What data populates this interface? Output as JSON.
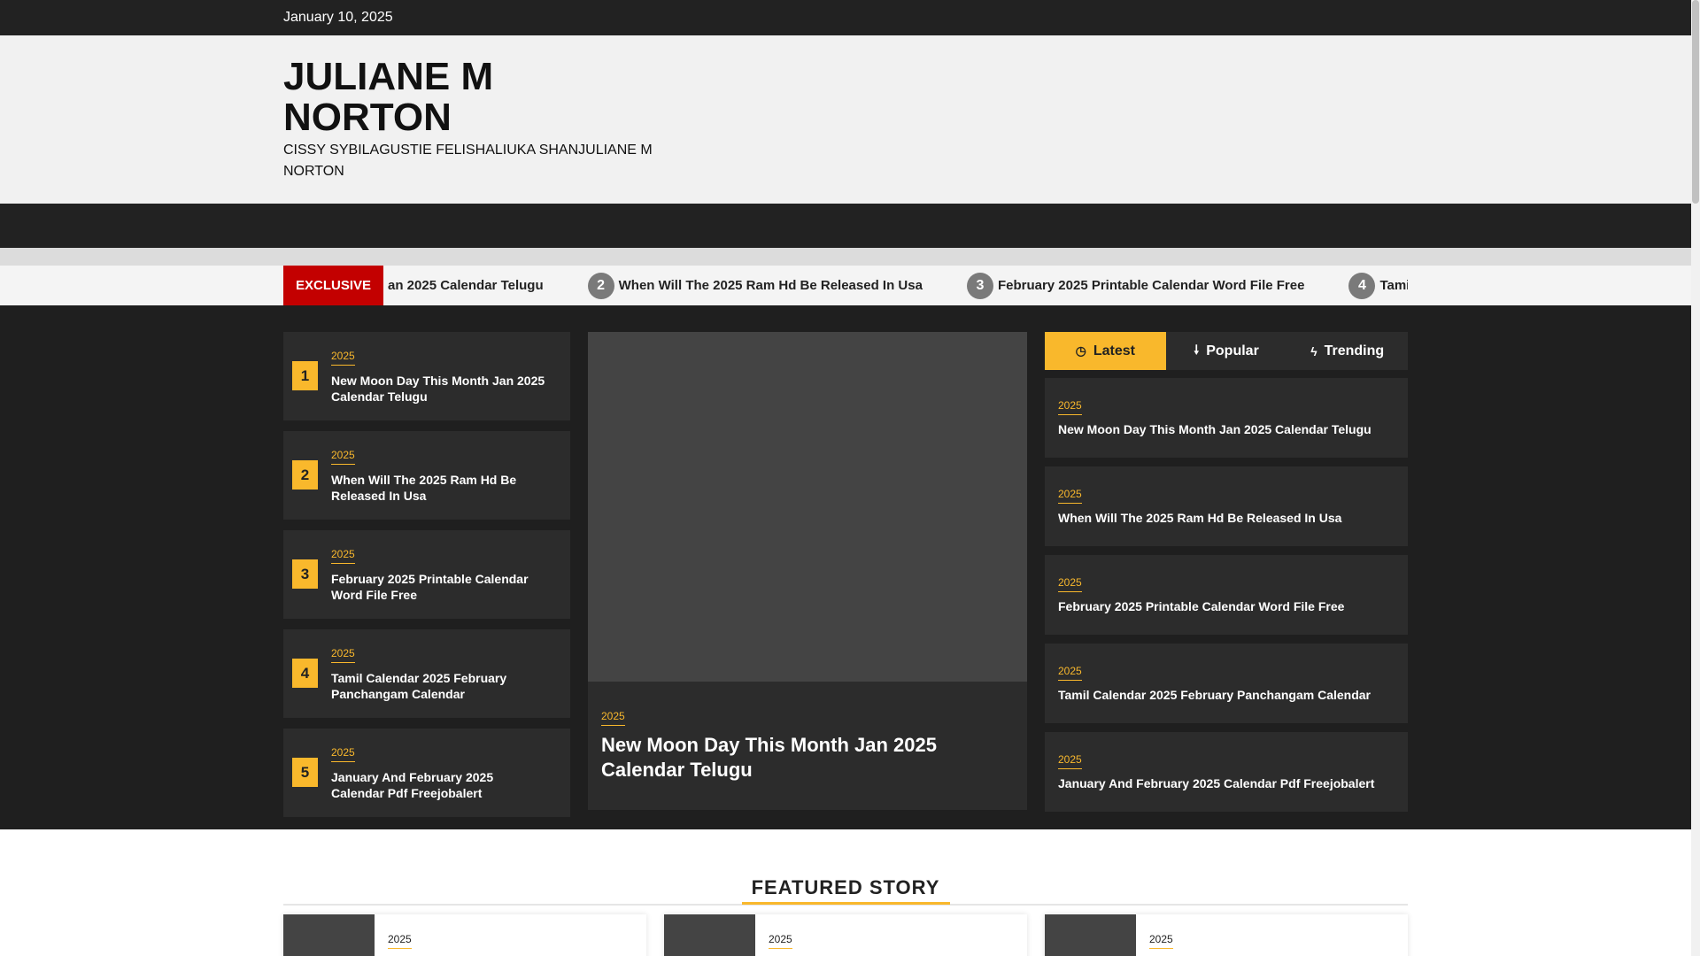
{
  "topbar": {
    "date": "January 10, 2025"
  },
  "header": {
    "site_title": "JULIANE M NORTON",
    "tagline": "CISSY SYBILAGUSTIE FELISHALIUKA SHANJULIANE M NORTON"
  },
  "ticker": {
    "label": "EXCLUSIVE",
    "items": [
      {
        "num": "",
        "title": "an 2025 Calendar Telugu"
      },
      {
        "num": "2",
        "title": "When Will The 2025 Ram Hd Be Released In Usa"
      },
      {
        "num": "3",
        "title": "February 2025 Printable Calendar Word File Free"
      },
      {
        "num": "4",
        "title": "Tamil Cale"
      }
    ]
  },
  "left_posts": [
    {
      "rank": "1",
      "category": "2025",
      "title": "New Moon Day This Month Jan 2025 Calendar Telugu"
    },
    {
      "rank": "2",
      "category": "2025",
      "title": "When Will The 2025 Ram Hd Be Released In Usa"
    },
    {
      "rank": "3",
      "category": "2025",
      "title": "February 2025 Printable Calendar Word File Free"
    },
    {
      "rank": "4",
      "category": "2025",
      "title": "Tamil Calendar 2025 February Panchangam Calendar"
    },
    {
      "rank": "5",
      "category": "2025",
      "title": "January And February 2025 Calendar Pdf Freejobalert"
    }
  ],
  "feature": {
    "category": "2025",
    "title": "New Moon Day This Month Jan 2025 Calendar Telugu"
  },
  "tabs": [
    {
      "icon": "clock-icon",
      "glyph": "◷",
      "label": "Latest"
    },
    {
      "icon": "fire-icon",
      "glyph": "🠗",
      "label": "Popular"
    },
    {
      "icon": "bolt-icon",
      "glyph": "ϟ",
      "label": "Trending"
    }
  ],
  "right_posts": [
    {
      "category": "2025",
      "title": "New Moon Day This Month Jan 2025 Calendar Telugu"
    },
    {
      "category": "2025",
      "title": "When Will The 2025 Ram Hd Be Released In Usa"
    },
    {
      "category": "2025",
      "title": "February 2025 Printable Calendar Word File Free"
    },
    {
      "category": "2025",
      "title": "Tamil Calendar 2025 February Panchangam Calendar"
    },
    {
      "category": "2025",
      "title": "January And February 2025 Calendar Pdf Freejobalert"
    }
  ],
  "featured_story": {
    "heading": "FEATURED STORY",
    "cards": [
      {
        "category": "2025"
      },
      {
        "category": "2025"
      },
      {
        "category": "2025"
      }
    ]
  },
  "colors": {
    "accent": "#f9b82c",
    "exclusive": "#c30000",
    "dark": "#1f1f1f",
    "card": "#2c2c2c"
  }
}
